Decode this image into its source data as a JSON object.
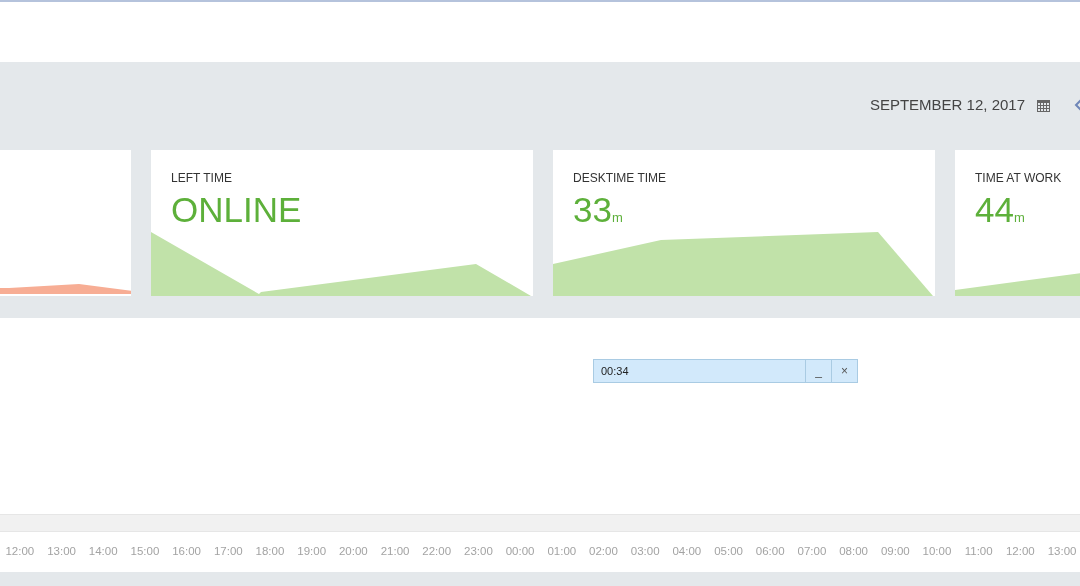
{
  "header": {
    "date": "SEPTEMBER 12, 2017"
  },
  "cards": [
    {
      "color": "#f7ad94"
    },
    {
      "label": "LEFT TIME",
      "value": "ONLINE",
      "color": "#c1e2a9"
    },
    {
      "label": "DESKTIME TIME",
      "value": "33",
      "unit": "m",
      "color": "#c1e2a9"
    },
    {
      "label": "TIME AT WORK",
      "value": "44",
      "unit": "m",
      "color": "#c1e2a9"
    }
  ],
  "popup": {
    "value": "00:34",
    "buttons": [
      "_",
      "×"
    ]
  },
  "timeline": [
    "12:00",
    "13:00",
    "14:00",
    "15:00",
    "16:00",
    "17:00",
    "18:00",
    "19:00",
    "20:00",
    "21:00",
    "22:00",
    "23:00",
    "00:00",
    "01:00",
    "02:00",
    "03:00",
    "04:00",
    "05:00",
    "06:00",
    "07:00",
    "08:00",
    "09:00",
    "10:00",
    "11:00",
    "12:00",
    "13:00"
  ]
}
